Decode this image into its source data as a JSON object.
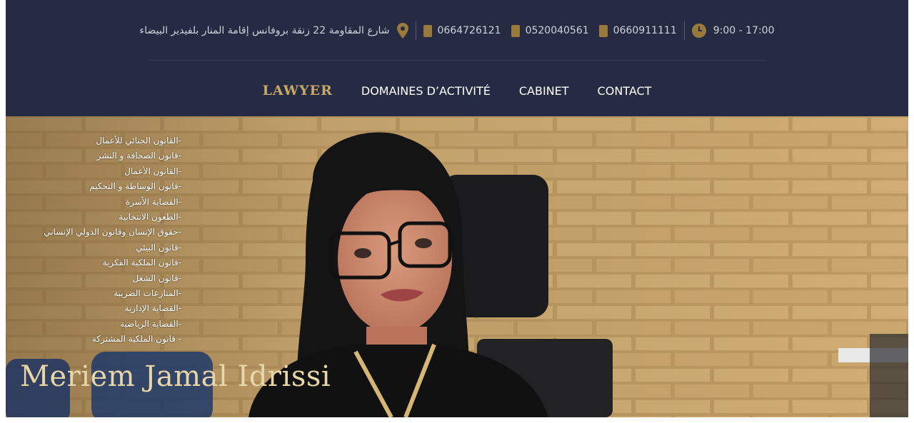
{
  "topbar": {
    "address": "شارع المقاومة 22 زنقة بروفانس إقامة المنار بلفيدير البيضاء",
    "phones": [
      "0664726121",
      "0520040561",
      "0660911111"
    ],
    "hours": "9:00 - 17:00"
  },
  "nav": {
    "logo": "LAWYER",
    "links": [
      "DOMAINES D’ACTIVITÉ",
      "CABINET",
      "CONTACT"
    ]
  },
  "hero": {
    "services": [
      "-القانون الجنائي للأعمال",
      "-قانون الصحافة و النشر",
      "-القانون الأعمال",
      "-قانون الوساطة و التحكيم",
      "-القضاية الأسرة",
      "-الطعون الانتخابية",
      "-حقوق الإنسان وقانون الدولي الإنساني",
      "-قانون البيئي",
      "-قانون الملكية الفكرية",
      "-قانون الشغل",
      "-المنازعات الضريبة",
      "-القضاية الإدارية",
      "-القضاية الرياضية",
      "- قانون الملكية المشتركة"
    ],
    "name": "Meriem Jamal Idrissi"
  },
  "colors": {
    "header_bg": "#252b42",
    "accent_gold": "#c9a867",
    "brick": "#c9a56b"
  }
}
